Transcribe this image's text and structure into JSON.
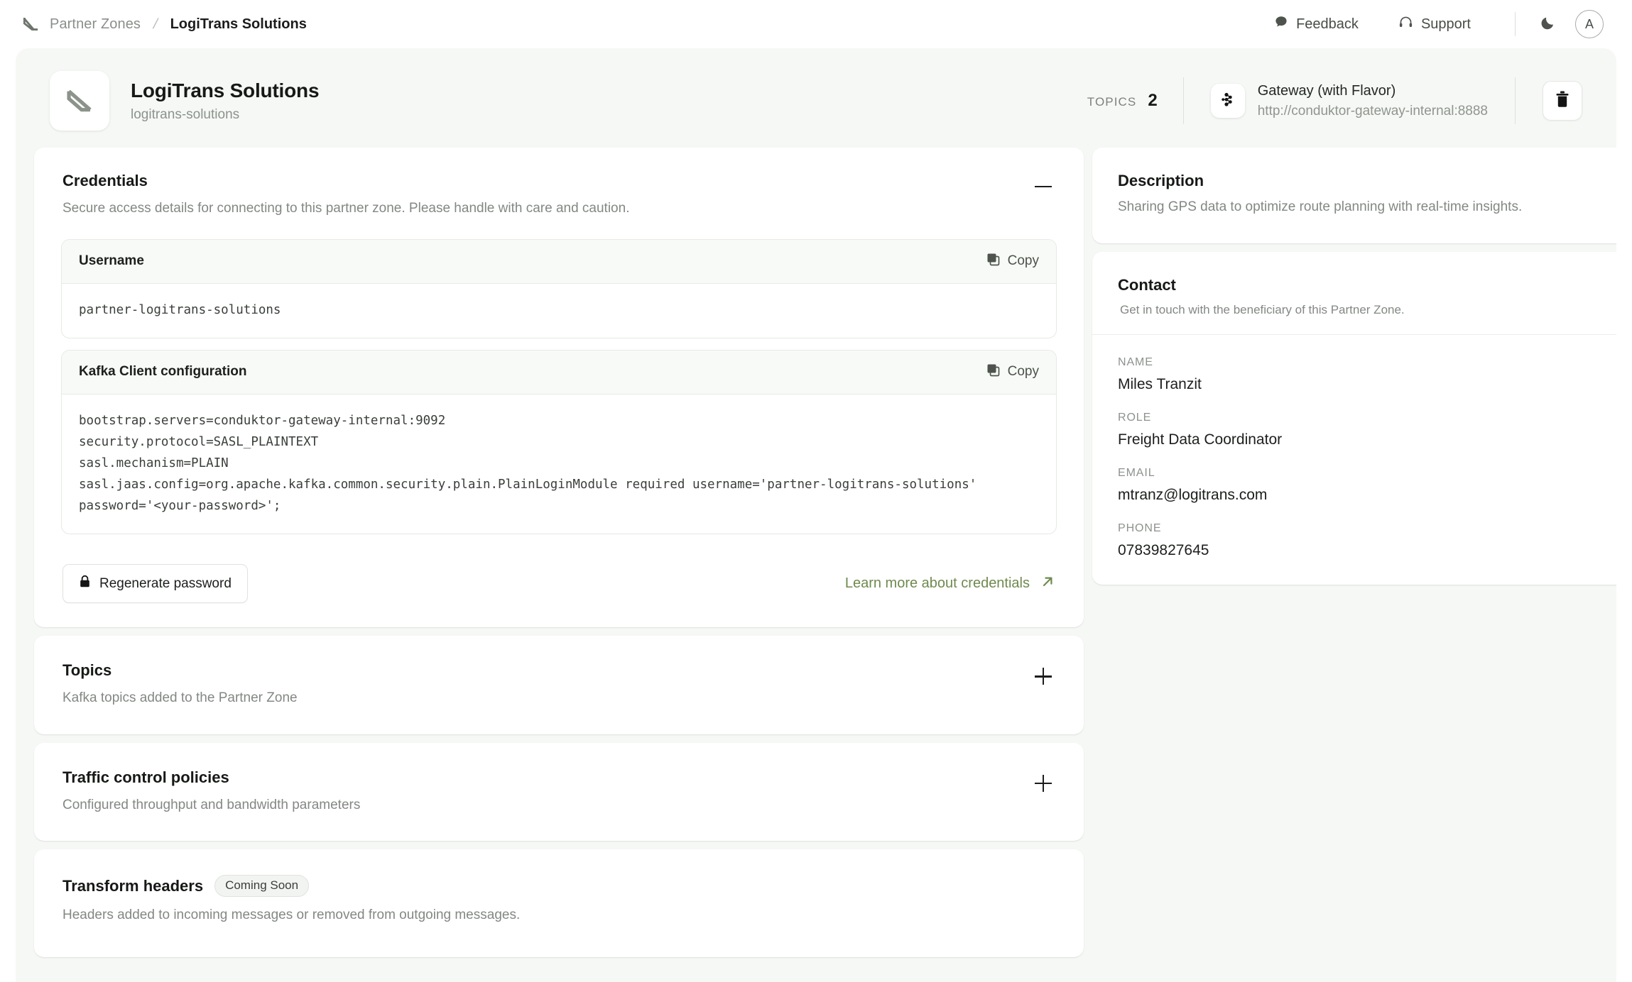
{
  "topbar": {
    "breadcrumb_root": "Partner Zones",
    "breadcrumb_separator": "/",
    "breadcrumb_current": "LogiTrans Solutions",
    "feedback_label": "Feedback",
    "support_label": "Support",
    "avatar_initial": "A",
    "icons": {
      "brand": "conduktor-logo-icon",
      "feedback": "chat-bubble-icon",
      "support": "headset-icon",
      "theme": "moon-icon"
    }
  },
  "page_header": {
    "title": "LogiTrans Solutions",
    "slug": "logitrans-solutions",
    "topics_label": "TOPICS",
    "topics_value": "2",
    "gateway_name": "Gateway (with Flavor)",
    "gateway_url": "http://conduktor-gateway-internal:8888"
  },
  "credentials": {
    "title": "Credentials",
    "subtitle": "Secure access details for connecting to this partner zone. Please handle with care and caution.",
    "collapse_state": "expanded",
    "username": {
      "label": "Username",
      "copy_label": "Copy",
      "value": "partner-logitrans-solutions"
    },
    "kafka": {
      "label": "Kafka Client configuration",
      "copy_label": "Copy",
      "value": "bootstrap.servers=conduktor-gateway-internal:9092\nsecurity.protocol=SASL_PLAINTEXT\nsasl.mechanism=PLAIN\nsasl.jaas.config=org.apache.kafka.common.security.plain.PlainLoginModule required username='partner-logitrans-solutions'\npassword='<your-password>';"
    },
    "regenerate_label": "Regenerate password",
    "learn_more_label": "Learn more about credentials",
    "learn_more_color": "#6f8a4e"
  },
  "topics_section": {
    "title": "Topics",
    "subtitle": "Kafka topics added to the Partner Zone",
    "collapse_state": "collapsed"
  },
  "traffic_section": {
    "title": "Traffic control policies",
    "subtitle": "Configured throughput and bandwidth parameters",
    "collapse_state": "collapsed"
  },
  "transform_section": {
    "title": "Transform headers",
    "badge": "Coming Soon",
    "subtitle": "Headers added to incoming messages or removed from outgoing messages."
  },
  "description_panel": {
    "title": "Description",
    "text": "Sharing GPS data to optimize route planning with real-time insights."
  },
  "contact_panel": {
    "title": "Contact",
    "subtitle": "Get in touch with the beneficiary of this Partner Zone.",
    "fields": [
      {
        "label": "NAME",
        "value": "Miles Tranzit"
      },
      {
        "label": "ROLE",
        "value": "Freight Data Coordinator"
      },
      {
        "label": "EMAIL",
        "value": "mtranz@logitrans.com"
      },
      {
        "label": "PHONE",
        "value": "07839827645"
      }
    ]
  }
}
